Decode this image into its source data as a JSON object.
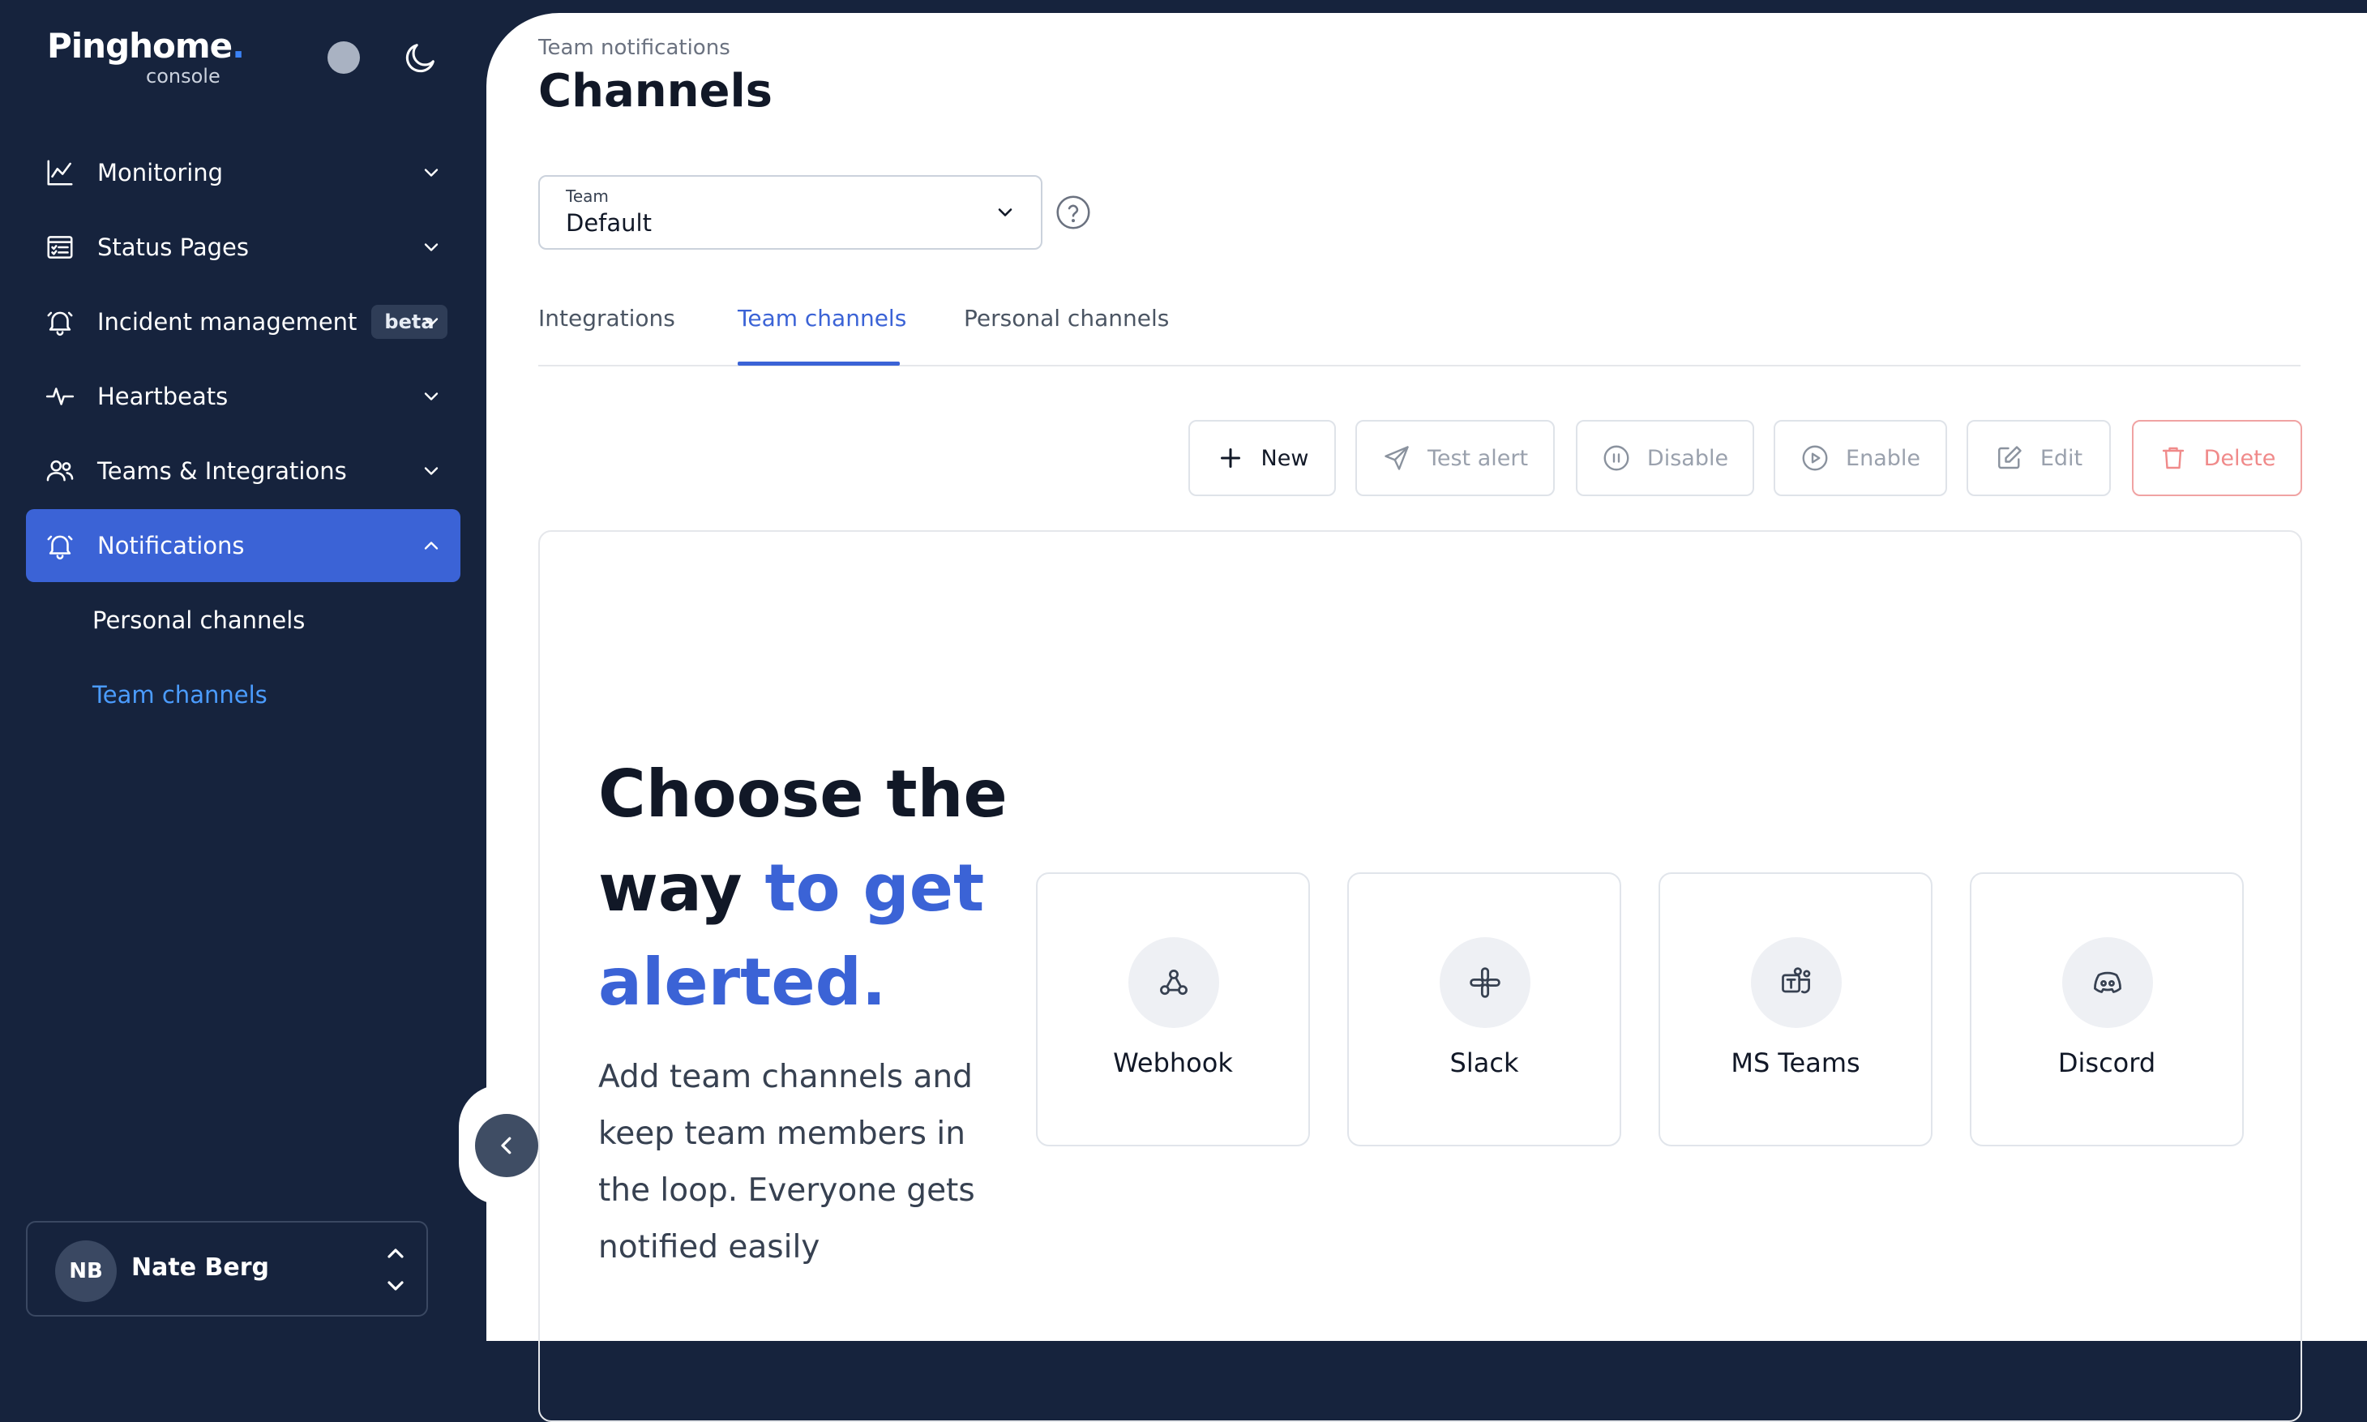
{
  "brand": {
    "name": "Pinghome",
    "dot": ".",
    "sub": "console"
  },
  "sidebar": {
    "items": [
      {
        "label": "Monitoring"
      },
      {
        "label": "Status Pages"
      },
      {
        "label": "Incident management",
        "badge": "beta"
      },
      {
        "label": "Heartbeats"
      },
      {
        "label": "Teams & Integrations"
      },
      {
        "label": "Notifications"
      }
    ],
    "subitems": [
      {
        "label": "Personal channels"
      },
      {
        "label": "Team channels"
      }
    ],
    "user": {
      "initials": "NB",
      "name": "Nate Berg"
    }
  },
  "header": {
    "breadcrumb": "Team notifications",
    "title": "Channels"
  },
  "team_select": {
    "label": "Team",
    "value": "Default"
  },
  "tabs": [
    {
      "label": "Integrations"
    },
    {
      "label": "Team channels"
    },
    {
      "label": "Personal channels"
    }
  ],
  "toolbar": {
    "new": "New",
    "test_alert": "Test alert",
    "disable": "Disable",
    "enable": "Enable",
    "edit": "Edit",
    "delete": "Delete"
  },
  "hero": {
    "line1": "Choose the",
    "line2a": "way ",
    "line2b": "to get",
    "line3": "alerted.",
    "description": "Add team channels and keep team members in the loop. Everyone gets notified easily"
  },
  "options": [
    {
      "label": "Webhook",
      "icon": "webhook-icon"
    },
    {
      "label": "Slack",
      "icon": "slack-icon"
    },
    {
      "label": "MS Teams",
      "icon": "ms-teams-icon"
    },
    {
      "label": "Discord",
      "icon": "discord-icon"
    }
  ],
  "colors": {
    "sidebar_bg": "#16233d",
    "accent": "#3b63d6",
    "active_link": "#4b9cff",
    "danger": "#f08a8a"
  }
}
